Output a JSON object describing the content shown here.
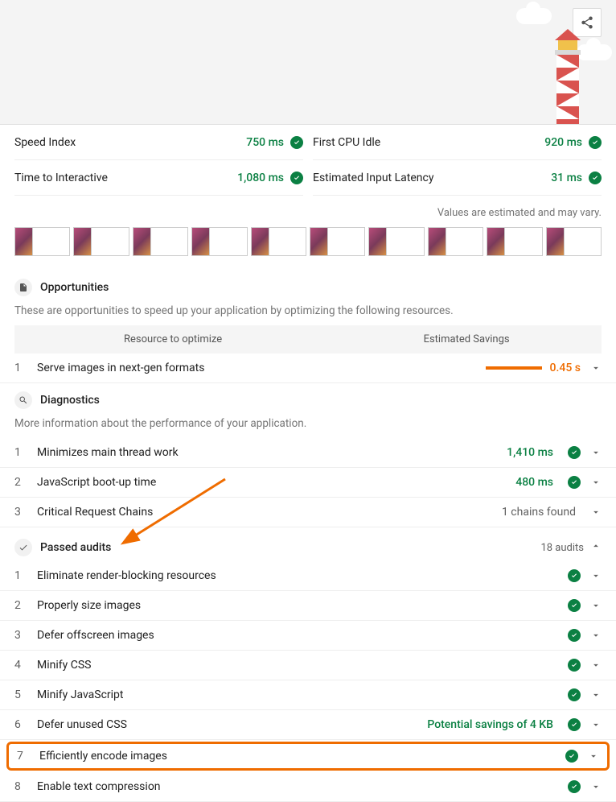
{
  "header": {
    "share_icon": "share-icon"
  },
  "metrics": {
    "left": [
      {
        "label": "Speed Index",
        "value": "750 ms"
      },
      {
        "label": "Time to Interactive",
        "value": "1,080 ms"
      }
    ],
    "right": [
      {
        "label": "First CPU Idle",
        "value": "920 ms"
      },
      {
        "label": "Estimated Input Latency",
        "value": "31 ms"
      }
    ],
    "estimated_note": "Values are estimated and may vary."
  },
  "filmstrip": {
    "frames": 10
  },
  "opportunities": {
    "title": "Opportunities",
    "description": "These are opportunities to speed up your application by optimizing the following resources.",
    "col1": "Resource to optimize",
    "col2": "Estimated Savings",
    "items": [
      {
        "num": "1",
        "title": "Serve images in next-gen formats",
        "savings": "0.45 s"
      }
    ]
  },
  "diagnostics": {
    "title": "Diagnostics",
    "description": "More information about the performance of your application.",
    "items": [
      {
        "num": "1",
        "title": "Minimizes main thread work",
        "value": "1,410 ms",
        "status": "pass"
      },
      {
        "num": "2",
        "title": "JavaScript boot-up time",
        "value": "480 ms",
        "status": "pass"
      },
      {
        "num": "3",
        "title": "Critical Request Chains",
        "value": "1 chains found",
        "status": "info"
      }
    ]
  },
  "passed": {
    "title": "Passed audits",
    "count": "18 audits",
    "items": [
      {
        "num": "1",
        "title": "Eliminate render-blocking resources"
      },
      {
        "num": "2",
        "title": "Properly size images"
      },
      {
        "num": "3",
        "title": "Defer offscreen images"
      },
      {
        "num": "4",
        "title": "Minify CSS"
      },
      {
        "num": "5",
        "title": "Minify JavaScript"
      },
      {
        "num": "6",
        "title": "Defer unused CSS",
        "value": "Potential savings of 4 KB"
      },
      {
        "num": "7",
        "title": "Efficiently encode images",
        "highlight": true
      },
      {
        "num": "8",
        "title": "Enable text compression"
      }
    ]
  }
}
